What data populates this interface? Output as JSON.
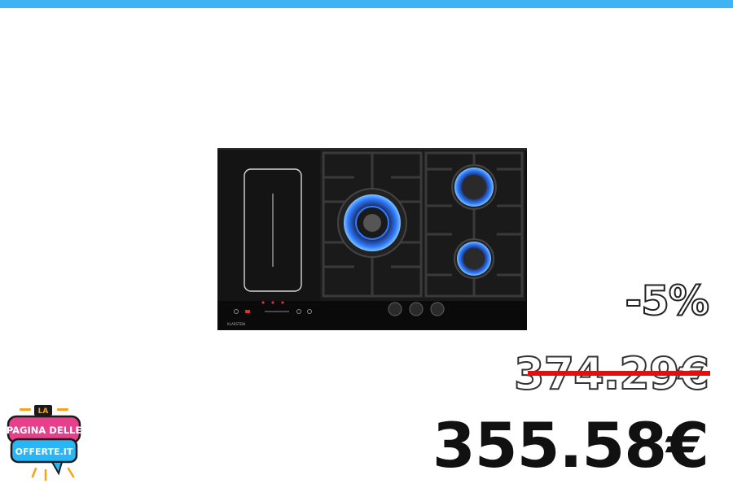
{
  "header": {
    "accent_color": "#3fb3f3"
  },
  "product": {
    "image_desc_icon": "cooktop-image"
  },
  "pricing": {
    "discount": "-5%",
    "old_price": "374.29€",
    "new_price": "355.58€",
    "strike_color": "#e01010"
  },
  "logo": {
    "line1": "LA",
    "line2": "PAGINA DELLE",
    "line3": "OFFERTE.IT"
  }
}
